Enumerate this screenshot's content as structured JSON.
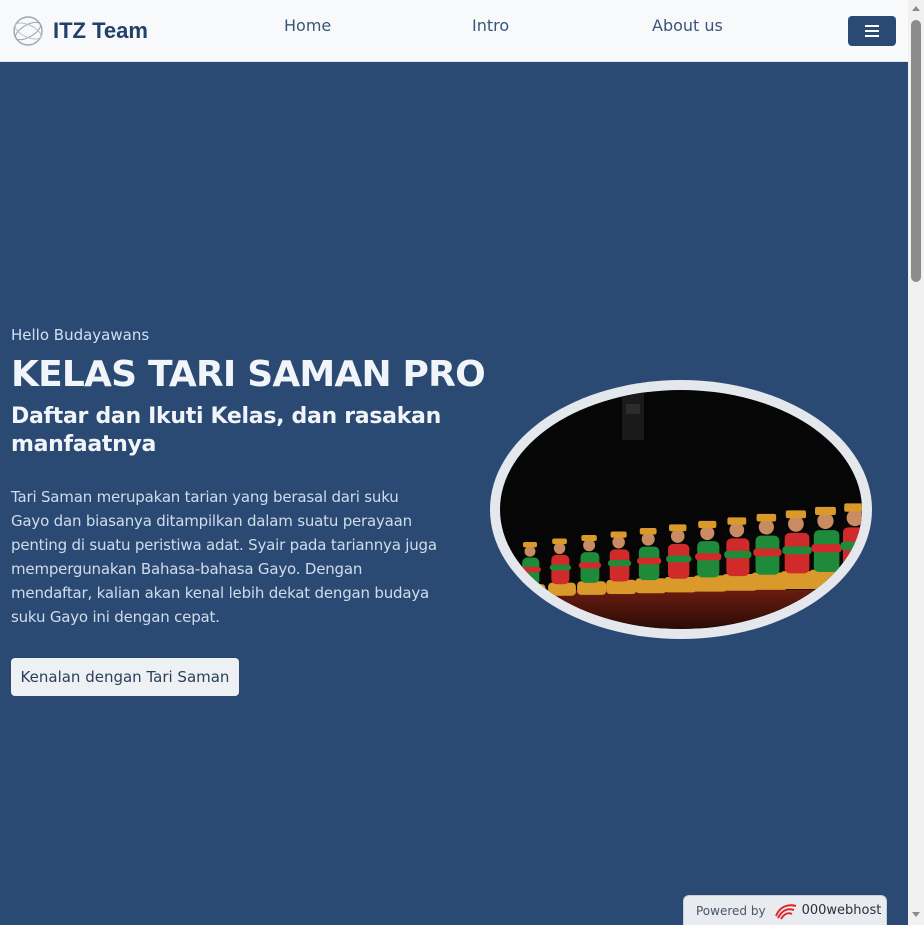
{
  "navbar": {
    "brand": "ITZ Team",
    "links": [
      "Home",
      "Intro",
      "About us"
    ],
    "menu_icon": "hamburger-icon"
  },
  "hero": {
    "greeting": "Hello Budayawans",
    "title": "KELAS TARI SAMAN PRO",
    "subtitle": "Daftar dan Ikuti Kelas, dan rasakan manfaatnya",
    "description": "Tari Saman merupakan tarian yang berasal dari suku Gayo dan biasanya ditampilkan dalam suatu perayaan penting di suatu peristiwa adat. Syair pada tariannya juga mempergunakan Bahasa-bahasa Gayo. Dengan mendaftar, kalian akan kenal lebih dekat dengan budaya suku Gayo ini dengan cepat.",
    "cta_label": "Kenalan dengan Tari Saman"
  },
  "footer_badge": {
    "label": "Powered by",
    "brand": "000webhost"
  },
  "colors": {
    "primary": "#2a4a74",
    "navbar_bg": "#f7f9fb",
    "button_bg": "#eef1f4",
    "dancer_red": "#d02a2a",
    "dancer_green": "#1f8a3a",
    "dancer_gold": "#d99a2b"
  }
}
